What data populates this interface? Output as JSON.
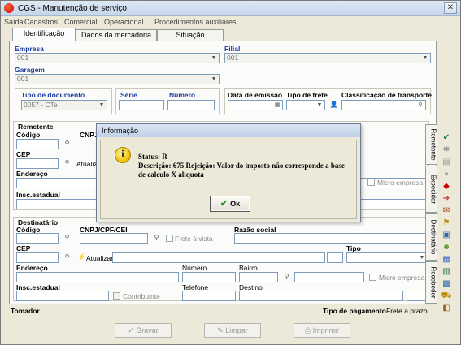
{
  "window": {
    "title": "CGS - Manutenção de serviço",
    "close_label": "✕"
  },
  "menu": [
    "Saída",
    "Cadastros",
    "Comercial",
    "Operacional",
    "Procedimentos auxiliares"
  ],
  "tabs": [
    "Identificação",
    "Dados da mercadoria",
    "Situação"
  ],
  "form": {
    "empresa_label": "Empresa",
    "empresa_value": "001",
    "filial_label": "Filial",
    "filial_value": "001",
    "garagem_label": "Garagem",
    "garagem_value": "001",
    "tipo_doc_label": "Tipo de documento",
    "tipo_doc_value": "0057 - CTe",
    "serie_label": "Série",
    "numero_label": "Número",
    "data_emissao_label": "Data de emissão",
    "tipo_frete_label": "Tipo de frete",
    "classificacao_label": "Classificação de transporte"
  },
  "remetente": {
    "title": "Remetente",
    "codigo_label": "Código",
    "cnpj_label": "CNPJ",
    "cep_label": "CEP",
    "atualizar_label": "Atualizar",
    "endereco_label": "Endereço",
    "insc_label": "Insc.estadual",
    "micro_empresa_label": "Micro empresa"
  },
  "destinatario": {
    "title": "Destinatário",
    "codigo_label": "Código",
    "cnpj_label": "CNPJ/CPF/CEI",
    "frete_vista_label": "Frete à vista",
    "razao_social_label": "Razão social",
    "cep_label": "CEP",
    "tipo_label": "Tipo",
    "atualizar_label": "Atualizar",
    "endereco_label": "Endereço",
    "numero_label": "Número",
    "bairro_label": "Bairro",
    "micro_empresa_label": "Micro empresa",
    "insc_label": "Insc.estadual",
    "contribuinte_label": "Contribuinte",
    "telefone_label": "Telefone",
    "destino_label": "Destino"
  },
  "side_tabs": [
    "Remetente",
    "Expedidor",
    "Destinatário",
    "Recebedor"
  ],
  "bottom": {
    "tomador_label": "Tomador",
    "tipo_pagamento_label": "Tipo de pagamento",
    "tipo_pagamento_value": "Frete a prazo"
  },
  "footer_buttons": [
    "Gravar",
    "Limpar",
    "Imprimir"
  ],
  "dialog": {
    "title": "Informação",
    "status_line": "Status: R",
    "descricao_line1": "Descrição: 675 Rejeição: Valor do imposto não corresponde a base",
    "descricao_line2": "de calculo X aliquota",
    "ok_label": "Ok"
  }
}
